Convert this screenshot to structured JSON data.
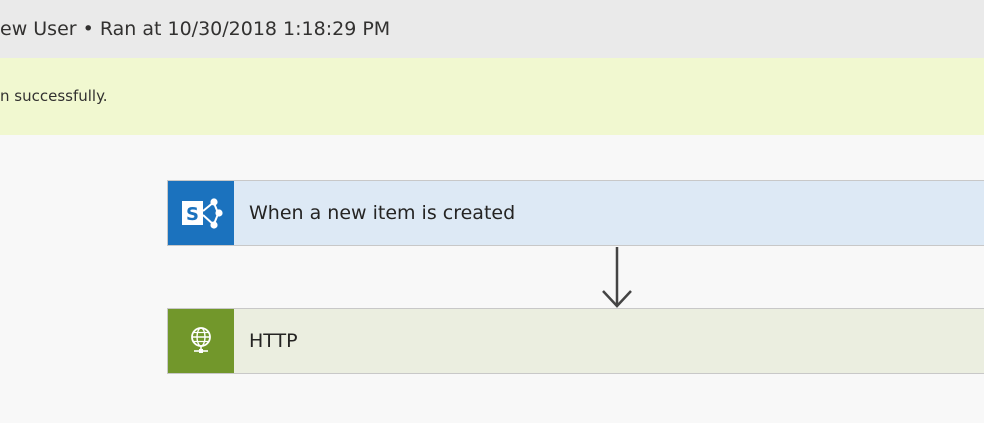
{
  "header": {
    "title": "ew User • Ran at 10/30/2018 1:18:29 PM"
  },
  "banner": {
    "message": "n successfully."
  },
  "flow": {
    "steps": [
      {
        "title": "When a new item is created",
        "icon": "sharepoint-icon",
        "color": "#1b72be"
      },
      {
        "title": "HTTP",
        "icon": "globe-icon",
        "color": "#72972b"
      }
    ]
  }
}
